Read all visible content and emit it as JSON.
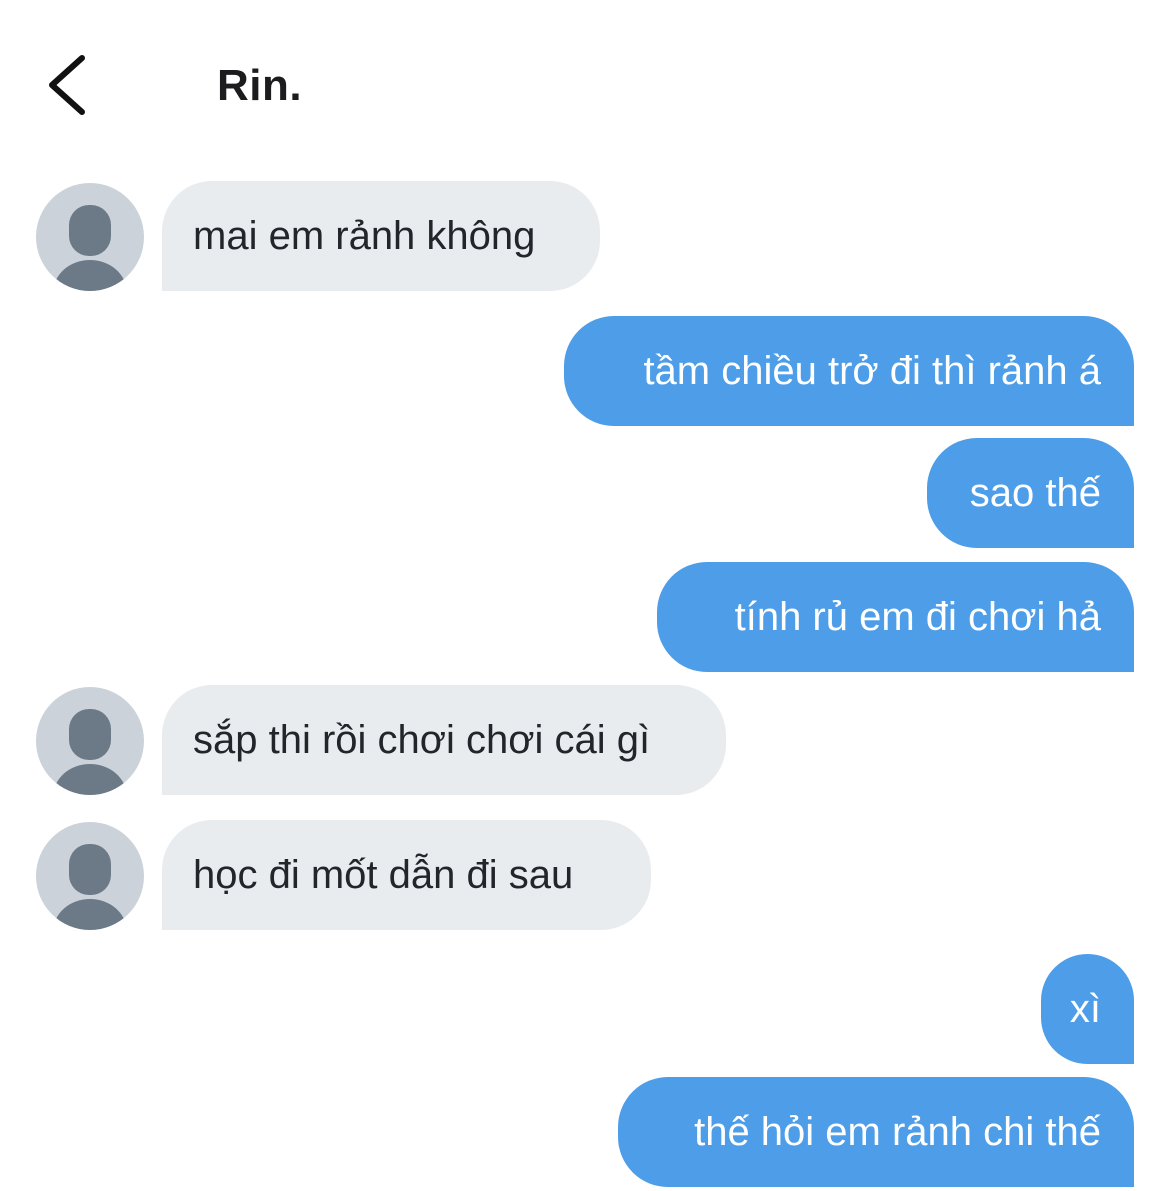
{
  "header": {
    "title": "Rin."
  },
  "messages": [
    {
      "direction": "incoming",
      "text": "mai em rảnh không"
    },
    {
      "direction": "outgoing",
      "text": "tầm chiều trở đi thì rảnh á"
    },
    {
      "direction": "outgoing",
      "text": "sao thế"
    },
    {
      "direction": "outgoing",
      "text": "tính rủ em đi chơi hả"
    },
    {
      "direction": "incoming",
      "text": "sắp thi rồi chơi chơi cái gì"
    },
    {
      "direction": "incoming",
      "text": "học đi mốt dẫn đi sau"
    },
    {
      "direction": "outgoing",
      "text": "xì"
    },
    {
      "direction": "outgoing",
      "text": "thế hỏi em rảnh chi thế"
    }
  ],
  "colors": {
    "incoming_bubble": "#e9ecef",
    "outgoing_bubble": "#4d9de8",
    "avatar_bg": "#ccd2d9",
    "avatar_fg": "#6c7a88"
  },
  "icons": {
    "back": "chevron-left-icon",
    "avatar": "default-user-avatar-icon"
  }
}
